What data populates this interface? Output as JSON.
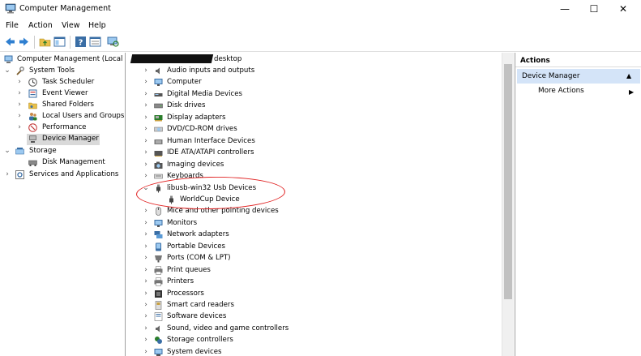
{
  "window": {
    "title": "Computer Management",
    "minimize": "—",
    "maximize": "☐",
    "close": "✕"
  },
  "menu": [
    "File",
    "Action",
    "View",
    "Help"
  ],
  "left_tree": [
    {
      "label": "Computer Management (Local",
      "icon": "computer-management-icon"
    },
    {
      "label": "System Tools",
      "icon": "tools-icon"
    },
    {
      "label": "Task Scheduler",
      "icon": "clock-icon"
    },
    {
      "label": "Event Viewer",
      "icon": "event-viewer-icon"
    },
    {
      "label": "Shared Folders",
      "icon": "shared-folder-icon"
    },
    {
      "label": "Local Users and Groups",
      "icon": "users-icon"
    },
    {
      "label": "Performance",
      "icon": "performance-icon"
    },
    {
      "label": "Device Manager",
      "icon": "device-manager-icon"
    },
    {
      "label": "Storage",
      "icon": "storage-icon"
    },
    {
      "label": "Disk Management",
      "icon": "disk-management-icon"
    },
    {
      "label": "Services and Applications",
      "icon": "services-icon"
    }
  ],
  "devices": {
    "root": "desktop",
    "items": [
      {
        "label": "Audio inputs and outputs",
        "icon": "speaker-icon"
      },
      {
        "label": "Computer",
        "icon": "monitor-icon"
      },
      {
        "label": "Digital Media Devices",
        "icon": "media-device-icon"
      },
      {
        "label": "Disk drives",
        "icon": "disk-drive-icon"
      },
      {
        "label": "Display adapters",
        "icon": "display-adapter-icon"
      },
      {
        "label": "DVD/CD-ROM drives",
        "icon": "dvd-icon"
      },
      {
        "label": "Human Interface Devices",
        "icon": "hid-icon"
      },
      {
        "label": "IDE ATA/ATAPI controllers",
        "icon": "ide-controller-icon"
      },
      {
        "label": "Imaging devices",
        "icon": "camera-icon"
      },
      {
        "label": "Keyboards",
        "icon": "keyboard-icon"
      },
      {
        "label": "libusb-win32 Usb Devices",
        "icon": "usb-icon"
      },
      {
        "label": "WorldCup Device",
        "icon": "usb-icon"
      },
      {
        "label": "Mice and other pointing devices",
        "icon": "mouse-icon"
      },
      {
        "label": "Monitors",
        "icon": "monitor-icon"
      },
      {
        "label": "Network adapters",
        "icon": "network-icon"
      },
      {
        "label": "Portable Devices",
        "icon": "portable-device-icon"
      },
      {
        "label": "Ports (COM & LPT)",
        "icon": "port-icon"
      },
      {
        "label": "Print queues",
        "icon": "printer-icon"
      },
      {
        "label": "Printers",
        "icon": "printer-icon"
      },
      {
        "label": "Processors",
        "icon": "processor-icon"
      },
      {
        "label": "Smart card readers",
        "icon": "smart-card-icon"
      },
      {
        "label": "Software devices",
        "icon": "software-device-icon"
      },
      {
        "label": "Sound, video and game controllers",
        "icon": "speaker-icon"
      },
      {
        "label": "Storage controllers",
        "icon": "storage-controller-icon"
      },
      {
        "label": "System devices",
        "icon": "system-device-icon"
      }
    ]
  },
  "actions": {
    "header": "Actions",
    "section": "Device Manager",
    "item": "More Actions"
  },
  "colors": {
    "selection": "#cce8ff",
    "action_section": "#d4e4f8",
    "annotation": "#e02020"
  }
}
